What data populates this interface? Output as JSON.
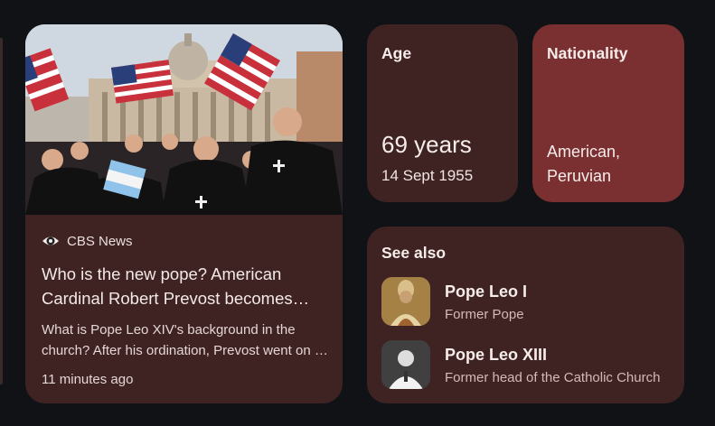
{
  "news": {
    "source": "CBS News",
    "source_icon": "eye-icon",
    "headline": "Who is the new pope? American Cardinal Robert Prevost becomes Pope Leo XIV",
    "snippet": "What is Pope Leo XIV's background in the church? After his ordination, Prevost went on to serve as a missionary",
    "time": "11 minutes ago",
    "image": "crowd-with-american-flags-st-peters-square"
  },
  "age": {
    "label": "Age",
    "value": "69 years",
    "birth_date": "14 Sept 1955"
  },
  "nationality": {
    "label": "Nationality",
    "value": "American, Peruvian"
  },
  "see_also": {
    "title": "See also",
    "items": [
      {
        "name": "Pope Leo I",
        "description": "Former Pope"
      },
      {
        "name": "Pope Leo XIII",
        "description": "Former head of the Catholic Church"
      }
    ]
  },
  "colors": {
    "background": "#111216",
    "card": "#3f2323",
    "accent_card": "#7a2f31",
    "text_primary": "#f6ecea",
    "text_secondary": "#d4b9b7"
  }
}
